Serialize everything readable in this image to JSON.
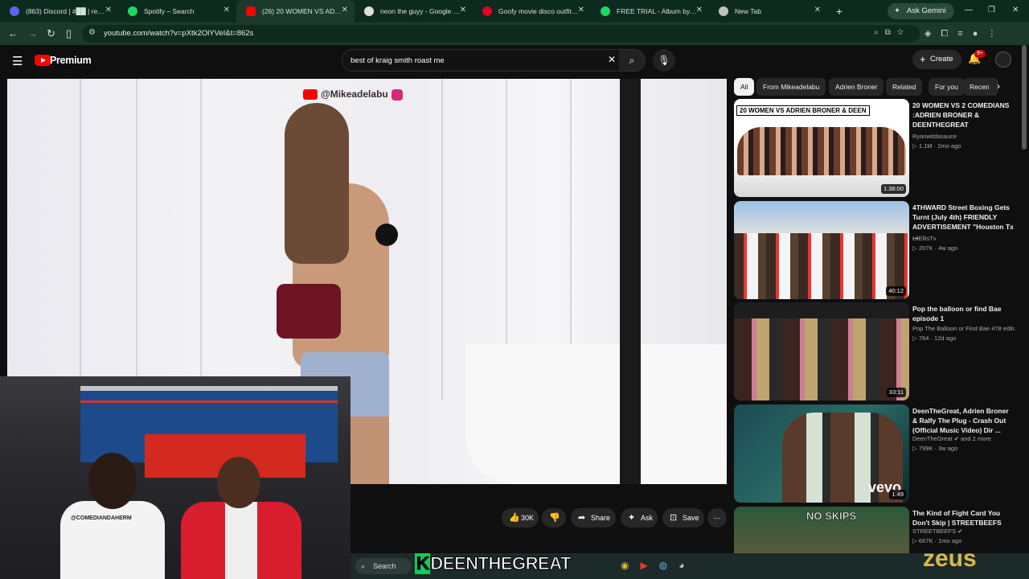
{
  "browser": {
    "tabs": [
      {
        "label": "(863) Discord | #██ | reactio",
        "color": "#5865f2",
        "active": false
      },
      {
        "label": "Spotify – Search",
        "color": "#1ed760",
        "active": false
      },
      {
        "label": "(26) 20 WOMEN VS ADRIEN",
        "color": "#ff0000",
        "active": true
      },
      {
        "label": "neon the guyy - Google Sea",
        "color": "#dddddd",
        "active": false
      },
      {
        "label": "Goofy movie disco outfit | S",
        "color": "#e60023",
        "active": false
      },
      {
        "label": "FREE TRIAL - Album by THE",
        "color": "#1ed760",
        "active": false
      },
      {
        "label": "New Tab",
        "color": "#c0c0c0",
        "active": false
      }
    ],
    "gemini_label": "Ask Gemini",
    "url": "youtube.com/watch?v=pXtk2OlYVeI&t=862s"
  },
  "youtube": {
    "brand": "Premium",
    "search_query": "best of kraig smith roast me",
    "create_label": "Create",
    "notification_count": "9+"
  },
  "video": {
    "watermark": "@Mikeadelabu",
    "overlay_text": "@COMEDIANDAHERM",
    "stream_banner": "DEENTHEGREAT",
    "stream_banner_k": "K",
    "brand_watermark": "zeus",
    "actions": {
      "like_count": "30K",
      "share_label": "Share",
      "ask_label": "Ask",
      "save_label": "Save"
    }
  },
  "taskbar": {
    "search_placeholder": "Search"
  },
  "chips": [
    "All",
    "From Mikeadelabu",
    "Adrien Broner",
    "Related",
    "For you",
    "Recen"
  ],
  "recommendations": [
    {
      "title": "20 WOMEN VS 2 COMEDIANS :ADRIEN BRONER & DEENTHEGREAT",
      "channel": "Ryanwitdasauce",
      "views": "1.1M",
      "age": "2mo ago",
      "duration": "1:38:00",
      "caption": "20 WOMEN VS ADRIEN BRONER & DEEN"
    },
    {
      "title": "4THWARD Street Boxing Gets Turnt (July 4th) FRIENDLY ADVERTISEMENT \"Houston Tx ...",
      "channel": "LilEllisTv",
      "views": "207K",
      "age": "4w ago",
      "duration": "40:12"
    },
    {
      "title": "Pop the balloon or find Bae episode 1",
      "channel": "Pop The Balloon or Find Bae 478 editi...",
      "views": "764",
      "age": "12d ago",
      "duration": "33:11"
    },
    {
      "title": "DeenTheGreat, Adrien Broner & Ralfy The Plug -  Crash Out (Official Music Video) Dir ...",
      "channel": "DeenTheGreat ✔ and 2 more",
      "views": "799K",
      "age": "3w ago",
      "duration": "1:49",
      "vevo": "vevo"
    },
    {
      "title": "The Kind of Fight Card You Don't Skip | STREETBEEFS",
      "channel": "STREETBEEFS ✔",
      "views": "667K",
      "age": "1mo ago",
      "caption": "NO SKIPS"
    }
  ]
}
